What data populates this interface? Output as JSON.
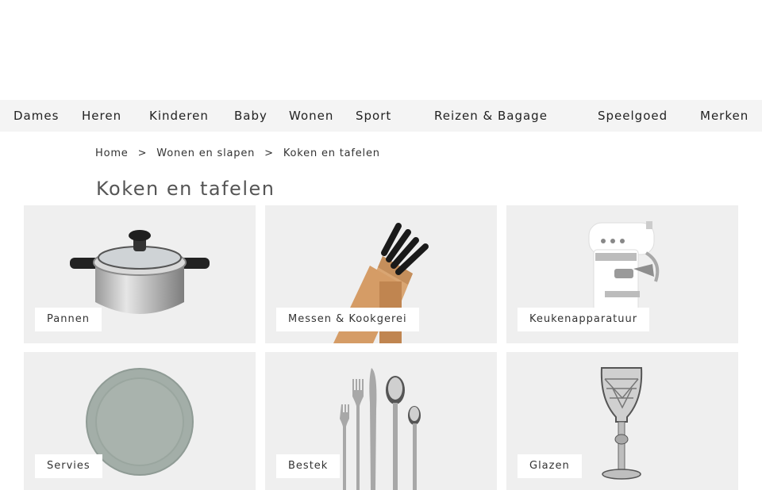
{
  "nav": {
    "items": [
      {
        "label": "Dames"
      },
      {
        "label": "Heren"
      },
      {
        "label": "Kinderen"
      },
      {
        "label": "Baby"
      },
      {
        "label": "Wonen"
      },
      {
        "label": "Sport"
      },
      {
        "label": "Reizen & Bagage"
      },
      {
        "label": "Speelgoed"
      },
      {
        "label": "Merken"
      }
    ]
  },
  "breadcrumb": {
    "items": [
      {
        "label": "Home"
      },
      {
        "label": "Wonen en slapen"
      },
      {
        "label": "Koken en tafelen"
      }
    ],
    "separator": ">"
  },
  "page": {
    "title": "Koken en tafelen"
  },
  "categories": [
    {
      "label": "Pannen",
      "image": "cooking-pot-icon"
    },
    {
      "label": "Messen & Kookgerei",
      "image": "knife-block-icon"
    },
    {
      "label": "Keukenapparatuur",
      "image": "espresso-machine-icon"
    },
    {
      "label": "Servies",
      "image": "plate-icon"
    },
    {
      "label": "Bestek",
      "image": "cutlery-icon"
    },
    {
      "label": "Glazen",
      "image": "wine-glass-icon"
    }
  ],
  "colors": {
    "nav_background": "#f4f4f4",
    "tile_background": "#efefef",
    "text": "#222222"
  }
}
